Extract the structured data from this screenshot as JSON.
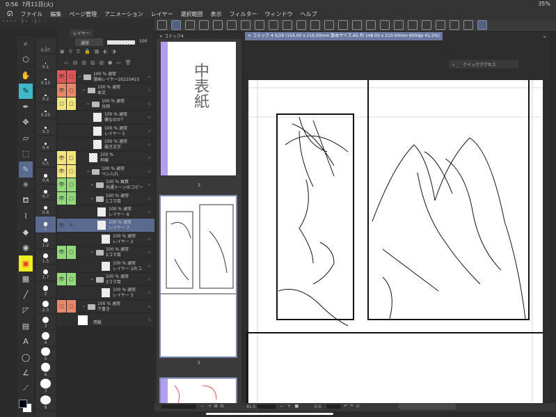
{
  "status": {
    "time": "0:56",
    "date": "7月11日(火)",
    "battery": "35%"
  },
  "menu": [
    "ファイル",
    "編集",
    "ページ管理",
    "アニメーション",
    "レイヤー",
    "選択範囲",
    "表示",
    "フィルター",
    "ウィンドウ",
    "ヘルプ"
  ],
  "layer_panel": {
    "title": "レイヤー",
    "blend_mode": "通常",
    "opacity": "100"
  },
  "layers": [
    {
      "opacity": "100 %",
      "mode": "通常",
      "name": "漫画レイヤー20210415",
      "type": "folder",
      "color": "#e0555a",
      "eye": true,
      "indent": 0
    },
    {
      "opacity": "100 %",
      "mode": "通常",
      "name": "本文",
      "type": "folder",
      "color": "#e9876a",
      "eye": true,
      "indent": 1
    },
    {
      "opacity": "100 %",
      "mode": "通常",
      "name": "台詞",
      "type": "folder",
      "color": "#f2e67a",
      "eye": false,
      "indent": 2
    },
    {
      "opacity": "100 %",
      "mode": "通常",
      "name": "僕なのか？",
      "type": "layer",
      "color": "",
      "eye": true,
      "indent": 3
    },
    {
      "opacity": "100 %",
      "mode": "通常",
      "name": "レイヤー 5",
      "type": "layer",
      "color": "",
      "eye": true,
      "indent": 3
    },
    {
      "opacity": "100 %",
      "mode": "通常",
      "name": "描き文字",
      "type": "layer",
      "color": "",
      "eye": true,
      "indent": 3
    },
    {
      "opacity": "100 %",
      "mode": "",
      "name": "枠線",
      "type": "layer",
      "color": "#f2e67a",
      "eye": true,
      "indent": 2
    },
    {
      "opacity": "100 %",
      "mode": "通常",
      "name": "ペン入れ",
      "type": "folder",
      "color": "#f2e67a",
      "eye": true,
      "indent": 2
    },
    {
      "opacity": "100 %",
      "mode": "乗算",
      "name": "共通トーンのコピー",
      "type": "folder",
      "color": "#93d87a",
      "eye": true,
      "indent": 3
    },
    {
      "opacity": "100 %",
      "mode": "通常",
      "name": "1コマ目",
      "type": "folder",
      "color": "#93d87a",
      "eye": true,
      "indent": 3
    },
    {
      "opacity": "100 %",
      "mode": "通常",
      "name": "レイヤー 8",
      "type": "layer",
      "color": "",
      "eye": true,
      "indent": 4
    },
    {
      "opacity": "100 %",
      "mode": "通常",
      "name": "レイヤー 7",
      "type": "layer",
      "color": "",
      "eye": true,
      "indent": 4,
      "selected": true
    },
    {
      "opacity": "100 %",
      "mode": "通常",
      "name": "レイヤー 2",
      "type": "layer",
      "color": "",
      "eye": true,
      "indent": 5
    },
    {
      "opacity": "100 %",
      "mode": "通常",
      "name": "2コマ目",
      "type": "folder",
      "color": "#93d87a",
      "eye": true,
      "indent": 3
    },
    {
      "opacity": "100 %",
      "mode": "通常",
      "name": "レイヤー 2のコ",
      "type": "layer",
      "color": "",
      "eye": true,
      "indent": 5
    },
    {
      "opacity": "100 %",
      "mode": "通常",
      "name": "3コマ目",
      "type": "folder",
      "color": "#93d87a",
      "eye": true,
      "indent": 3
    },
    {
      "opacity": "100 %",
      "mode": "通常",
      "name": "レイヤー 3",
      "type": "layer",
      "color": "",
      "eye": true,
      "indent": 5
    },
    {
      "opacity": "100 %",
      "mode": "通常",
      "name": "下書き",
      "type": "folder",
      "color": "#e9876a",
      "eye": false,
      "indent": 1
    },
    {
      "opacity": "",
      "mode": "",
      "name": "用紙",
      "type": "paper",
      "color": "",
      "eye": true,
      "indent": 0
    }
  ],
  "brush_sizes": [
    "0.07",
    "0.1",
    "0.15",
    "0.2",
    "0.25",
    "0.3",
    "0.4",
    "0.5",
    "0.6",
    "0.7",
    "0.8",
    "1",
    "1.2",
    "1.5",
    "1.7",
    "2",
    "2.5",
    "3",
    "4",
    "5",
    "6",
    "7",
    "8"
  ],
  "selected_brush_size": "1",
  "tools": [
    "magnifier",
    "move-view",
    "hand",
    "pen-select",
    "pen",
    "move",
    "eraser-like",
    "rect-select",
    "pen-active",
    "magic-wand",
    "stamp",
    "lasso-fill",
    "eraser",
    "blend",
    "fill-color",
    "gradient",
    "line",
    "frame",
    "tone",
    "text",
    "balloon",
    "ruler",
    "eyedropper"
  ],
  "pages_panel": {
    "tab": "コミック4",
    "page_labels": [
      "3",
      "5"
    ]
  },
  "canvas": {
    "tab": "コミック 4 5/28 (154.00 x 216.00mm 製本サイズ:A5 判 148.00 x 210.00mm 600dpi 41.5%)",
    "quick_access": "クイックアクセス",
    "zoom": "41.5",
    "angle": "0.0"
  }
}
